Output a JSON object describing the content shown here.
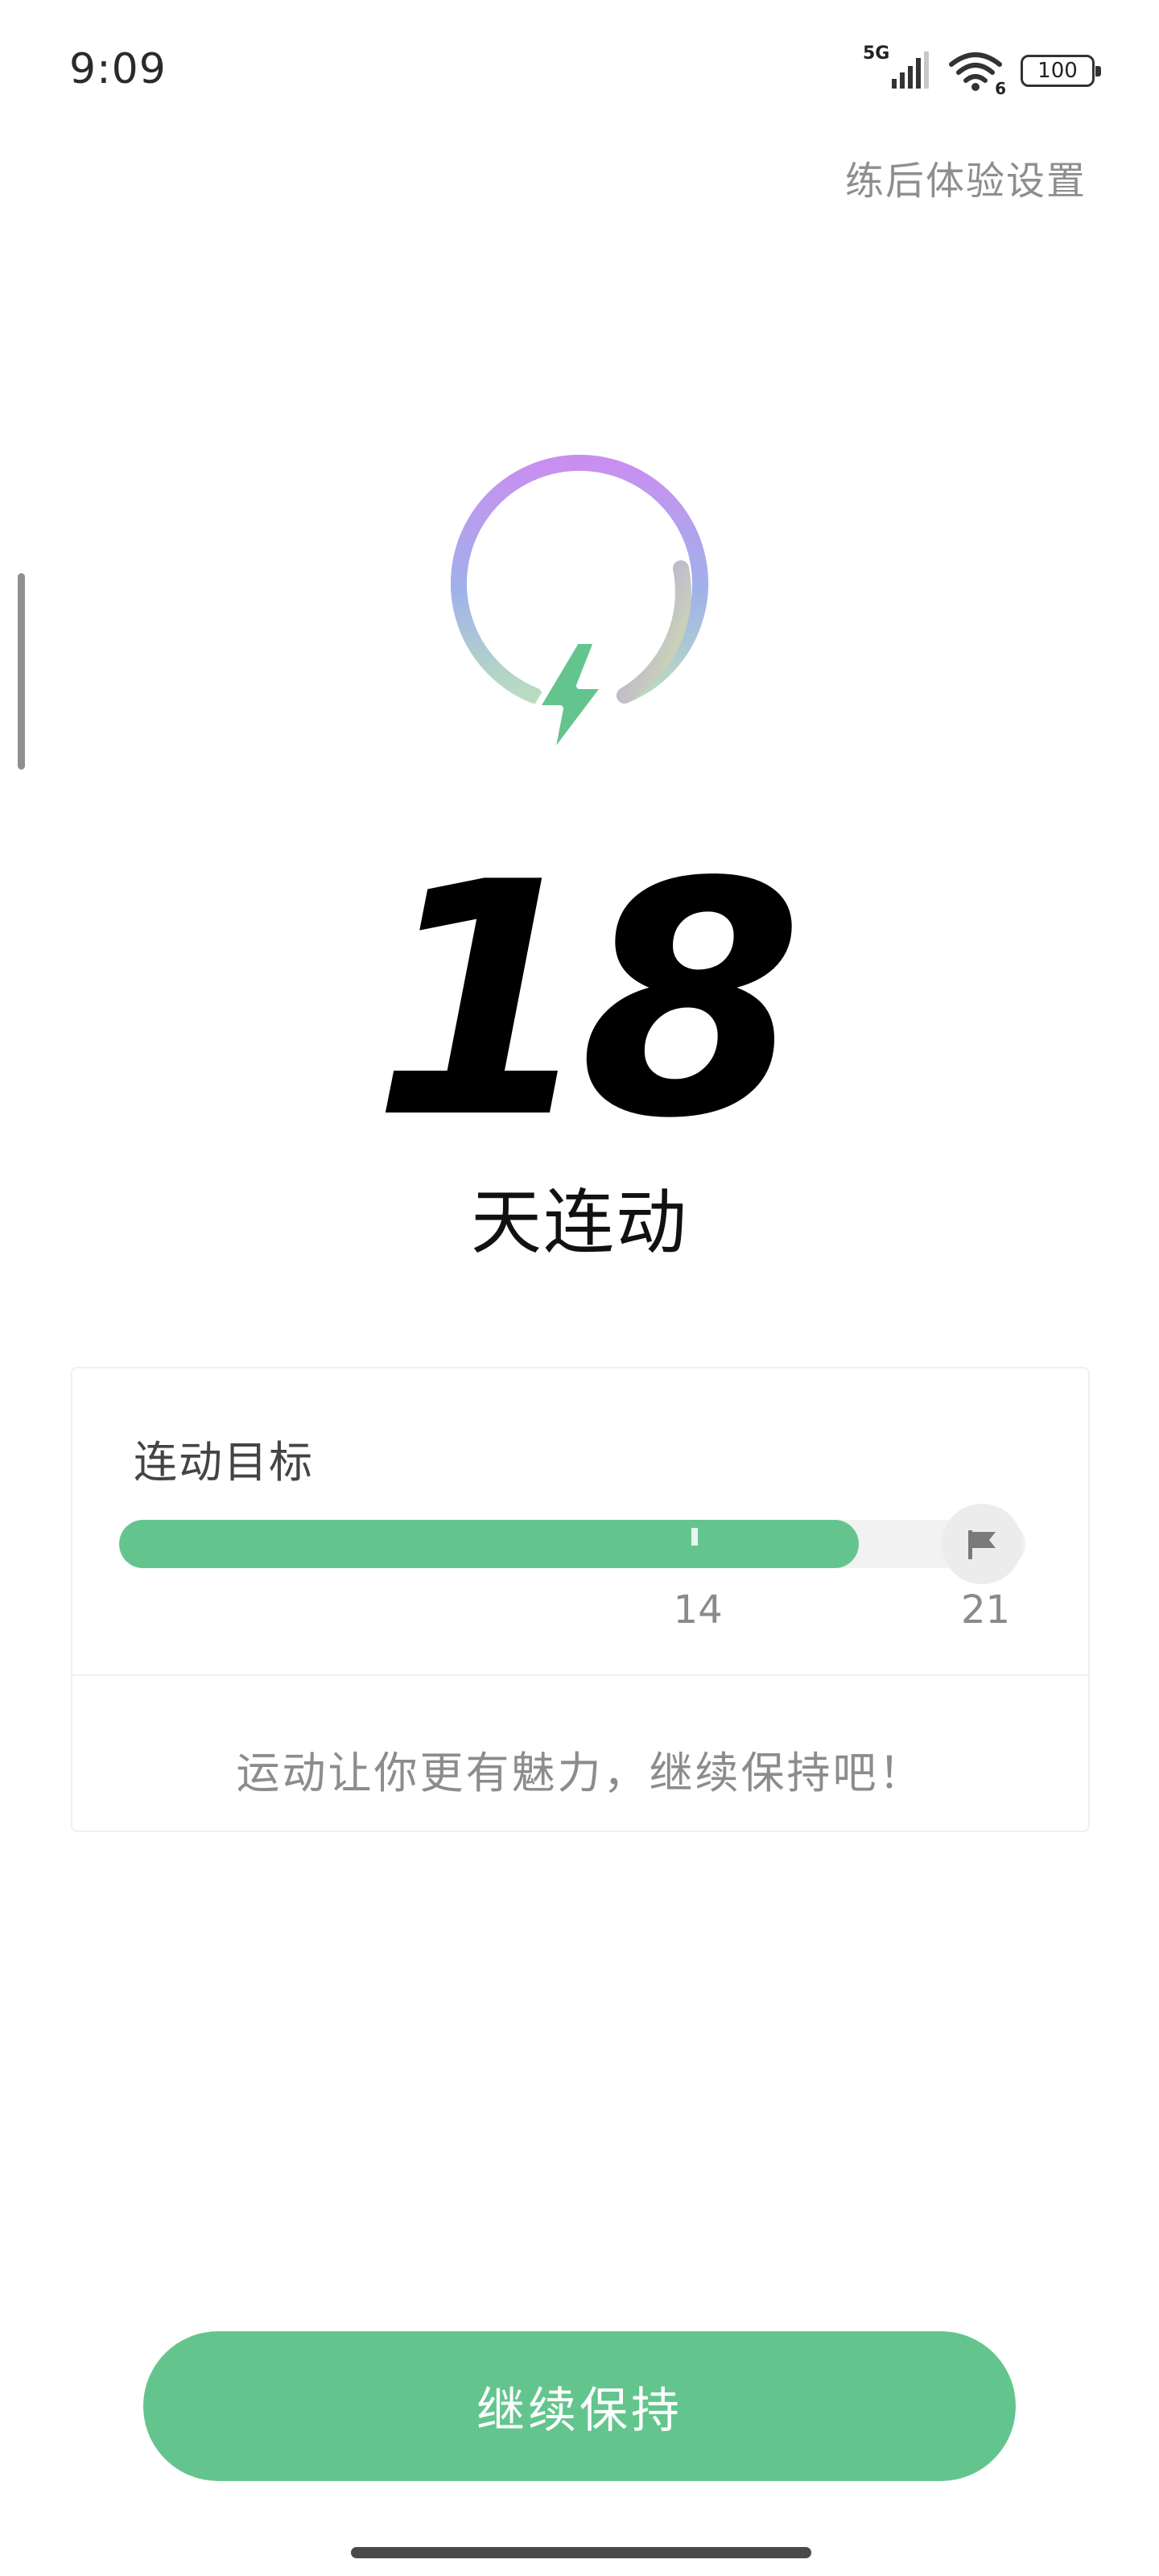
{
  "status_bar": {
    "time": "9:09",
    "network": "5G",
    "wifi_badge": "6",
    "battery": "100",
    "icons": [
      "signal-icon",
      "wifi-icon",
      "battery-icon"
    ]
  },
  "header": {
    "settings_link": "练后体验设置"
  },
  "logo": {
    "icon": "lightning-ring-icon",
    "colors": {
      "ring_top": "#c98ff0",
      "ring_left": "#93b4e8",
      "ring_right": "#c5dfa8",
      "bolt": "#63c58d"
    }
  },
  "streak": {
    "count": "18",
    "unit": "天连动"
  },
  "goal_card": {
    "title": "连动目标",
    "current": 18,
    "milestone": 14,
    "target": 21,
    "milestone_label": "14",
    "target_label": "21",
    "flag_icon": "flag-icon",
    "motivation": "运动让你更有魅力，继续保持吧！",
    "colors": {
      "fill": "#63c58d",
      "track": "#f2f2f2"
    }
  },
  "footer": {
    "button_label": "继续保持",
    "button_color": "#63c58d"
  }
}
